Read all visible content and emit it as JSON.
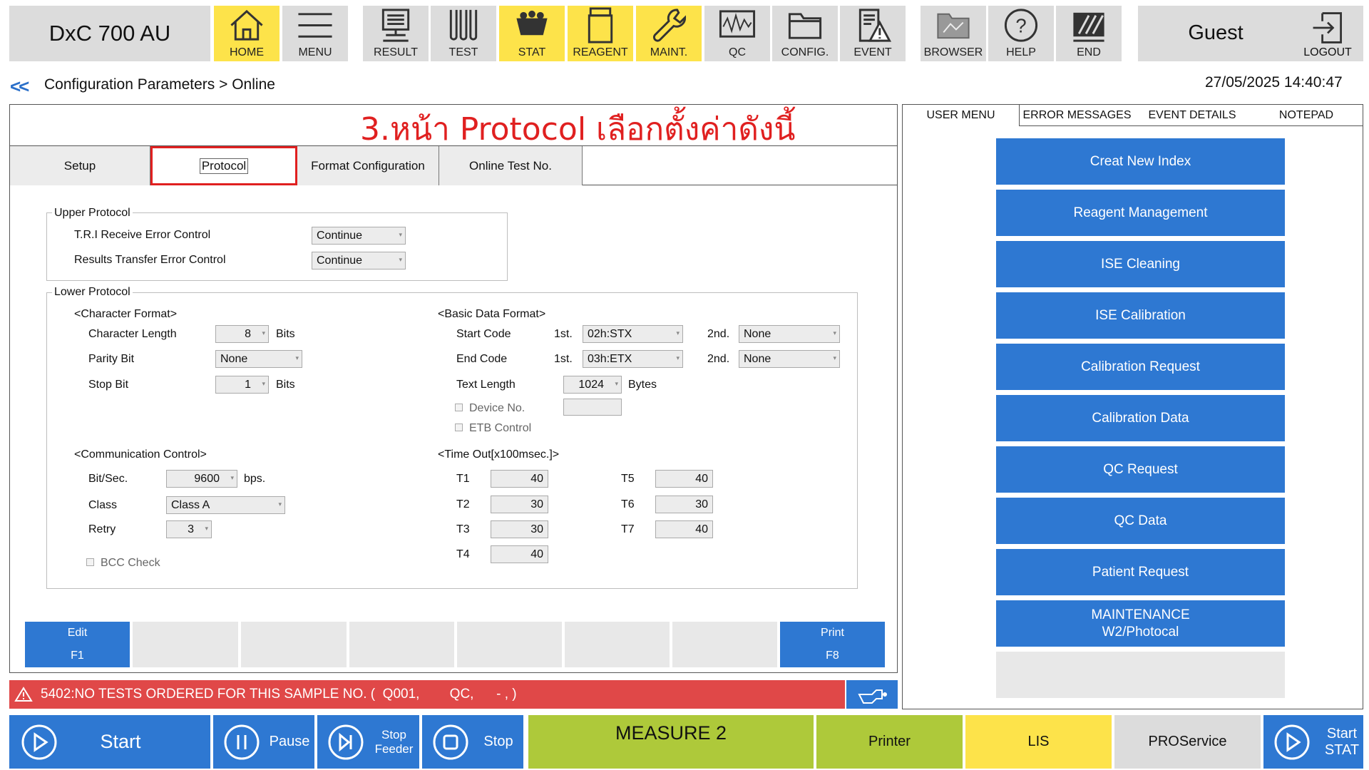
{
  "app": {
    "title": "DxC 700 AU"
  },
  "toolbar": [
    {
      "label": "HOME",
      "icon": "home-icon",
      "active": true
    },
    {
      "label": "MENU",
      "icon": "menu-icon",
      "active": false
    },
    {
      "label": "RESULT",
      "icon": "result-icon",
      "active": false
    },
    {
      "label": "TEST",
      "icon": "test-icon",
      "active": false
    },
    {
      "label": "STAT",
      "icon": "stat-icon",
      "active": true
    },
    {
      "label": "REAGENT",
      "icon": "reagent-icon",
      "active": true
    },
    {
      "label": "MAINT.",
      "icon": "wrench-icon",
      "active": true
    },
    {
      "label": "QC",
      "icon": "qc-icon",
      "active": false
    },
    {
      "label": "CONFIG.",
      "icon": "folder-icon",
      "active": false
    },
    {
      "label": "EVENT",
      "icon": "event-icon",
      "active": false
    },
    {
      "label": "BROWSER",
      "icon": "browser-icon",
      "active": false
    },
    {
      "label": "HELP",
      "icon": "help-icon",
      "active": false
    },
    {
      "label": "END",
      "icon": "end-icon",
      "active": false
    }
  ],
  "user": {
    "name": "Guest",
    "logout_label": "LOGOUT"
  },
  "nav": {
    "back": "<<",
    "breadcrumb": "Configuration Parameters > Online",
    "datetime": "27/05/2025 14:40:47"
  },
  "annotation": "3.หน้า Protocol เลือกตั้งค่าดังนี้",
  "tabs": [
    "Setup",
    "Protocol",
    "Format Configuration",
    "Online Test No."
  ],
  "upper_protocol": {
    "title": "Upper Protocol",
    "tri_label": "T.R.I Receive Error Control",
    "tri_value": "Continue",
    "results_label": "Results Transfer Error Control",
    "results_value": "Continue"
  },
  "lower_protocol": {
    "title": "Lower Protocol",
    "char_format": {
      "title": "<Character Format>",
      "length_label": "Character Length",
      "length_value": "8",
      "length_unit": "Bits",
      "parity_label": "Parity Bit",
      "parity_value": "None",
      "stop_label": "Stop Bit",
      "stop_value": "1",
      "stop_unit": "Bits"
    },
    "basic_format": {
      "title": "<Basic Data Format>",
      "start_label": "Start Code",
      "first": "1st.",
      "second": "2nd.",
      "start_1": "02h:STX",
      "start_2": "None",
      "end_label": "End Code",
      "end_1": "03h:ETX",
      "end_2": "None",
      "text_length_label": "Text Length",
      "text_length_value": "1024",
      "text_length_unit": "Bytes",
      "device_label": "Device No.",
      "device_value": "",
      "etb_label": "ETB Control"
    },
    "comm_control": {
      "title": "<Communication Control>",
      "bit_label": "Bit/Sec.",
      "bit_value": "9600",
      "bit_unit": "bps.",
      "class_label": "Class",
      "class_value": "Class A",
      "retry_label": "Retry",
      "retry_value": "3",
      "bcc_label": "BCC Check"
    },
    "timeout": {
      "title": "<Time Out[x100msec.]>",
      "T1": "40",
      "T2": "30",
      "T3": "30",
      "T4": "40",
      "T5": "40",
      "T6": "30",
      "T7": "40"
    }
  },
  "fkeys": {
    "edit": "Edit",
    "edit_key": "F1",
    "print": "Print",
    "print_key": "F8"
  },
  "error": {
    "message": "5402:NO TESTS ORDERED FOR THIS SAMPLE NO. (  Q001,        QC,      - , )"
  },
  "right_tabs": [
    "USER MENU",
    "ERROR MESSAGES",
    "EVENT DETAILS",
    "NOTEPAD"
  ],
  "user_menu": [
    "Creat New Index",
    "Reagent Management",
    "ISE Cleaning",
    "ISE Calibration",
    "Calibration Request",
    "Calibration Data",
    "QC Request",
    "QC Data",
    "Patient Request",
    "MAINTENANCE",
    "W2/Photocal"
  ],
  "bottom": {
    "start": "Start",
    "pause": "Pause",
    "stop_feeder_1": "Stop",
    "stop_feeder_2": "Feeder",
    "stop": "Stop",
    "measure": "MEASURE 2",
    "printer": "Printer",
    "lis": "LIS",
    "proservice": "PROService",
    "start_stat_1": "Start",
    "start_stat_2": "STAT"
  },
  "colors": {
    "blue": "#2e78d2",
    "yellow": "#fde34a",
    "green": "#aec93a",
    "red": "#e04848",
    "gray": "#dcdcdc"
  }
}
